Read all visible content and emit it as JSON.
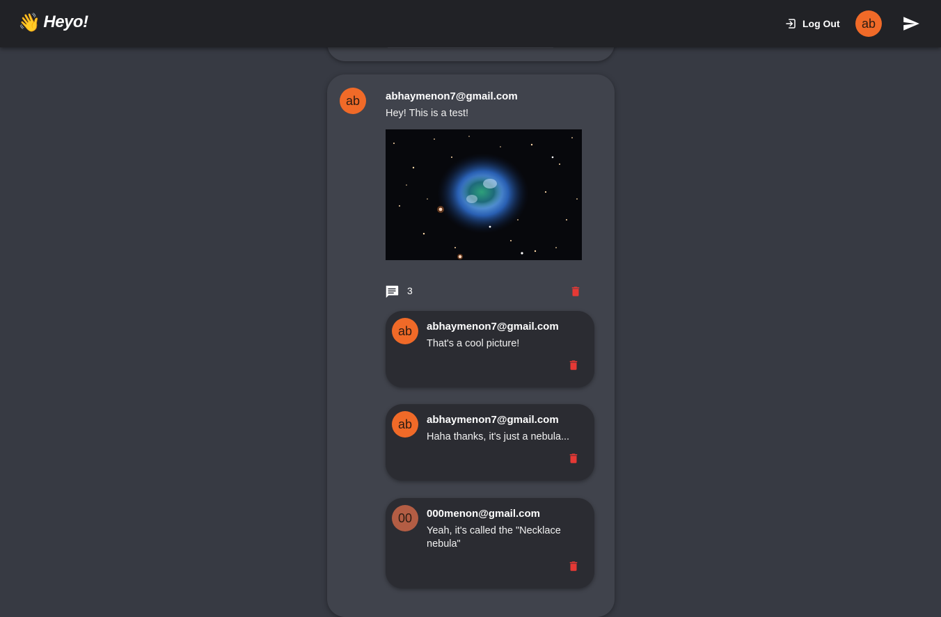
{
  "app": {
    "brand": "Heyo!",
    "brand_emoji": "👋"
  },
  "header": {
    "logout_label": "Log Out",
    "user_avatar": "ab",
    "icons": [
      "logout-icon",
      "send-icon"
    ]
  },
  "colors": {
    "background": "#373a43",
    "topbar": "#212226",
    "card": "#40434c",
    "comment": "#2b2c32",
    "accent": "#f06a28",
    "danger": "#e53935"
  },
  "post": {
    "avatar": "ab",
    "author": "abhaymenon7@gmail.com",
    "text": "Hey! This is a test!",
    "comment_count": "3",
    "comments": [
      {
        "avatar": "ab",
        "author": "abhaymenon7@gmail.com",
        "text": "That's a cool picture!"
      },
      {
        "avatar": "ab",
        "author": "abhaymenon7@gmail.com",
        "text": "Haha thanks, it's just a nebula..."
      },
      {
        "avatar": "00",
        "author": "000menon@gmail.com",
        "text": "Yeah, it's called the \"Necklace nebula\""
      }
    ]
  }
}
